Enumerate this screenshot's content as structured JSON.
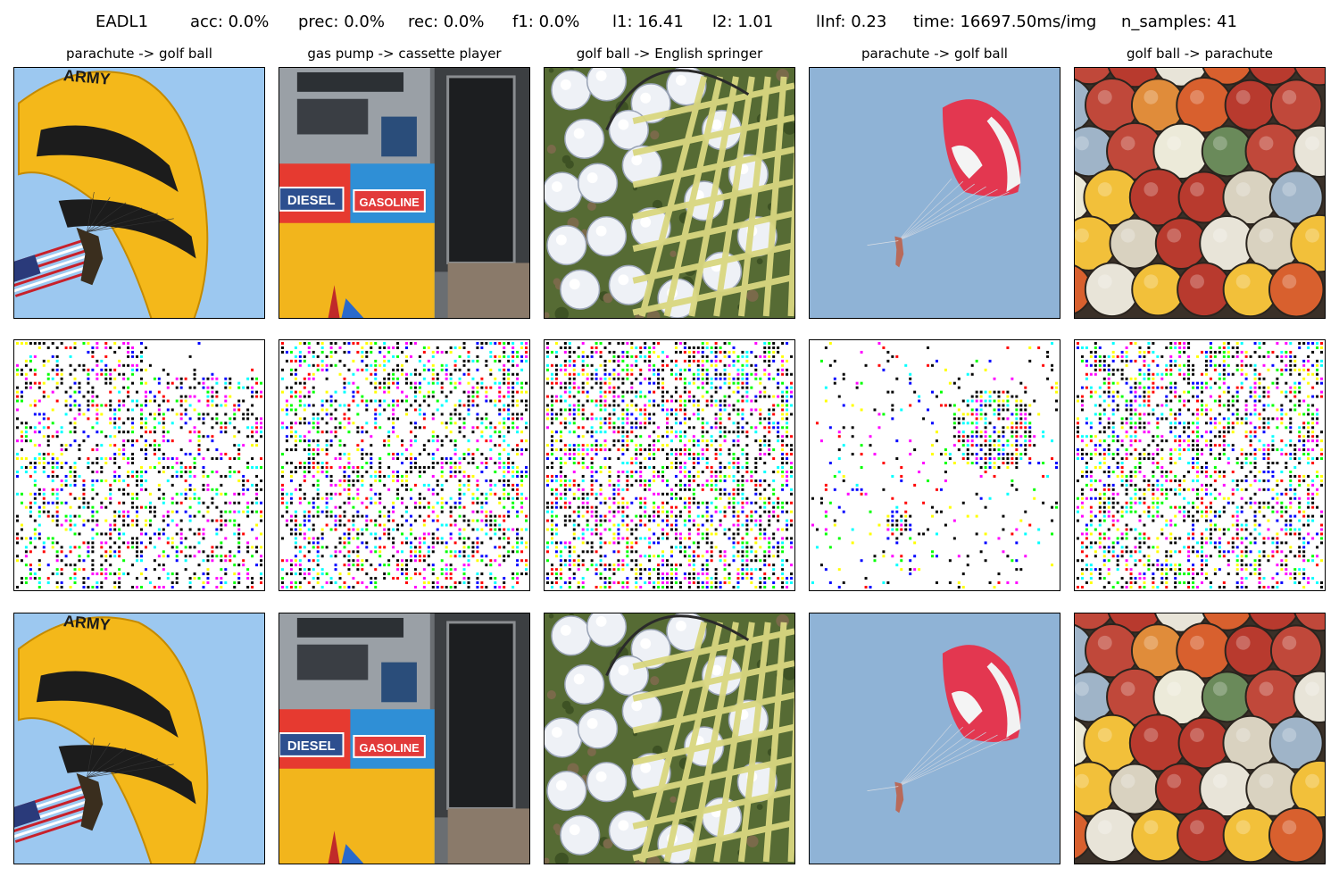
{
  "header": {
    "method": "EADL1",
    "acc": "acc: 0.0%",
    "prec": "prec: 0.0%",
    "rec": "rec: 0.0%",
    "f1": "f1: 0.0%",
    "l1": "l1: 16.41",
    "l2": "l2: 1.01",
    "linf": "lInf: 0.23",
    "time": "time: 16697.50ms/img",
    "n_samples": "n_samples: 41"
  },
  "columns": [
    {
      "title": "parachute -> golf ball",
      "scene": "army-parachute"
    },
    {
      "title": "gas pump -> cassette player",
      "scene": "gas-pump"
    },
    {
      "title": "golf ball -> English springer",
      "scene": "golf-basket"
    },
    {
      "title": "parachute -> golf ball",
      "scene": "red-parasail"
    },
    {
      "title": "golf ball -> parachute",
      "scene": "colored-balls"
    }
  ],
  "scene_text": {
    "army": "ARMY",
    "diesel": "DIESEL",
    "gasoline": "GASOLINE"
  },
  "rows": [
    "original",
    "perturbation",
    "adversarial"
  ]
}
